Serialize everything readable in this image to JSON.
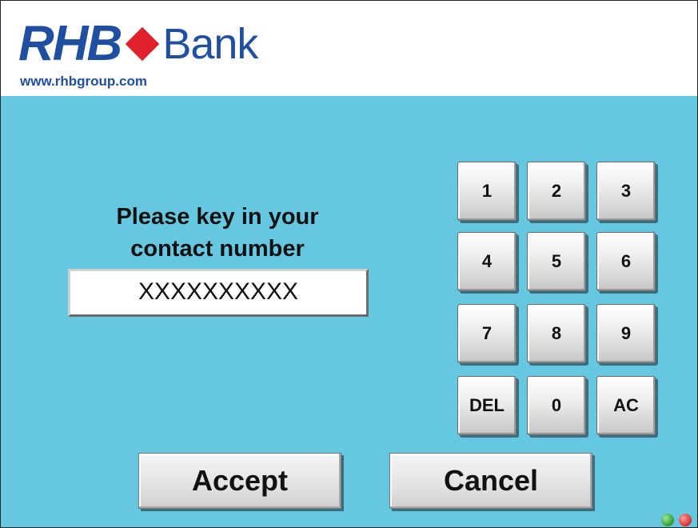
{
  "header": {
    "logo_text": "RHB",
    "logo_bank": "Bank",
    "url": "www.rhbgroup.com",
    "brand_blue": "#1f4fa0",
    "brand_red": "#e0202a"
  },
  "screen": {
    "background": "#66c8e0",
    "prompt_line1": "Please key in your",
    "prompt_line2": "contact number",
    "contact_value": "XXXXXXXXXX"
  },
  "keypad": {
    "keys": [
      "1",
      "2",
      "3",
      "4",
      "5",
      "6",
      "7",
      "8",
      "9",
      "DEL",
      "0",
      "AC"
    ]
  },
  "actions": {
    "accept_label": "Accept",
    "cancel_label": "Cancel"
  },
  "indicators": {
    "green": "#3aa83a",
    "red": "#e03a3a"
  }
}
